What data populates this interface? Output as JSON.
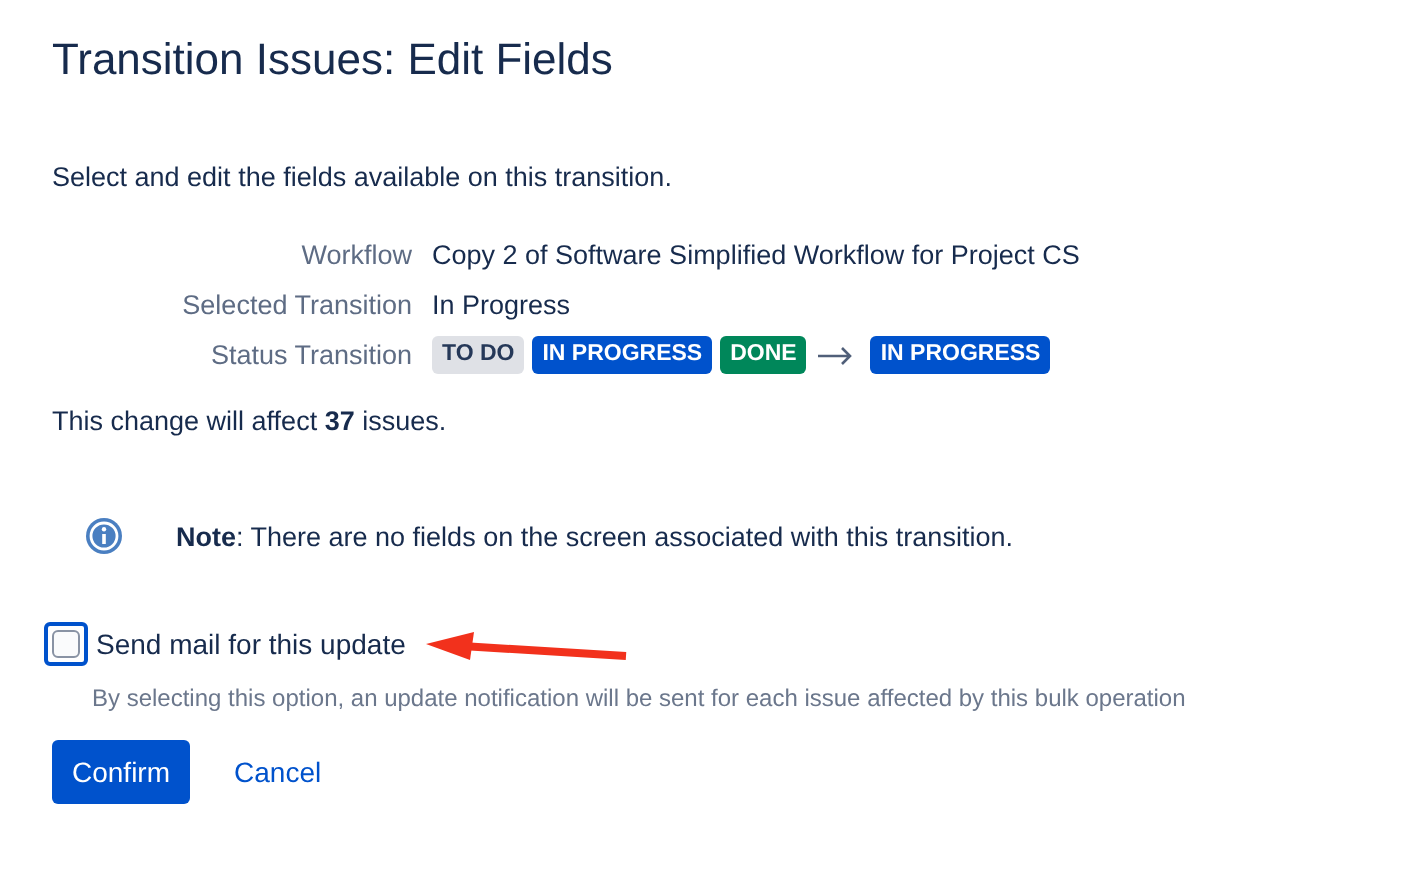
{
  "title": "Transition Issues: Edit Fields",
  "intro": "Select and edit the fields available on this transition.",
  "details": [
    {
      "label": "Workflow",
      "value": "Copy 2 of Software Simplified Workflow for Project CS"
    },
    {
      "label": "Selected Transition",
      "value": "In Progress"
    }
  ],
  "status_transition": {
    "label": "Status Transition",
    "from": [
      {
        "text": "TO DO",
        "color": "#dfe1e6"
      },
      {
        "text": "IN PROGRESS",
        "color": "#0052cc"
      },
      {
        "text": "DONE",
        "color": "#00875a"
      }
    ],
    "to": [
      {
        "text": "IN PROGRESS",
        "color": "#0052cc"
      }
    ]
  },
  "affect": "This change will affect **37** issues.",
  "note": "**Note**: There are no fields on the screen associated with this transition.",
  "send_mail": {
    "label": "Send mail for this update",
    "checked": false,
    "focused": true,
    "hint": "By selecting this option, an update notification will be sent for each issue affected by this bulk operation"
  },
  "buttons": [
    {
      "label": "Confirm",
      "kind": "primary"
    },
    {
      "label": "Cancel",
      "kind": "link"
    }
  ]
}
